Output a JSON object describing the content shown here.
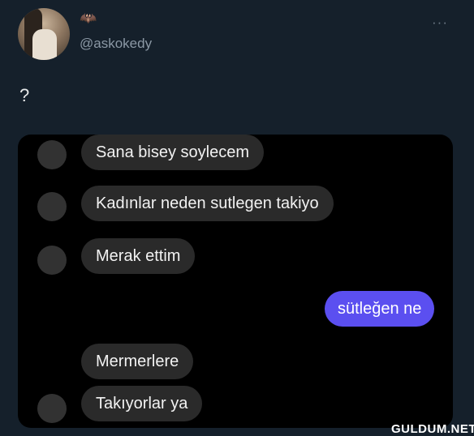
{
  "tweet": {
    "handle": "@askokedy",
    "badge_icon": "🦇",
    "more_icon": "···",
    "text": "?"
  },
  "chat": {
    "messages": [
      {
        "direction": "received",
        "text": "Sana bisey soylecem",
        "has_avatar": true
      },
      {
        "direction": "received",
        "text": "Kadınlar neden sutlegen takiyo",
        "has_avatar": true
      },
      {
        "direction": "received",
        "text": "Merak ettim",
        "has_avatar": true
      },
      {
        "direction": "sent",
        "text": "sütleğen ne",
        "has_avatar": false
      },
      {
        "direction": "received",
        "text": "Mermerlere",
        "has_avatar": false
      },
      {
        "direction": "received",
        "text": "Takıyorlar ya",
        "has_avatar": true
      }
    ],
    "colors": {
      "background": "#000000",
      "received_bubble": "#2a2a2a",
      "sent_bubble": "#5b4ff0"
    }
  },
  "watermark": "GULDUM.NET"
}
